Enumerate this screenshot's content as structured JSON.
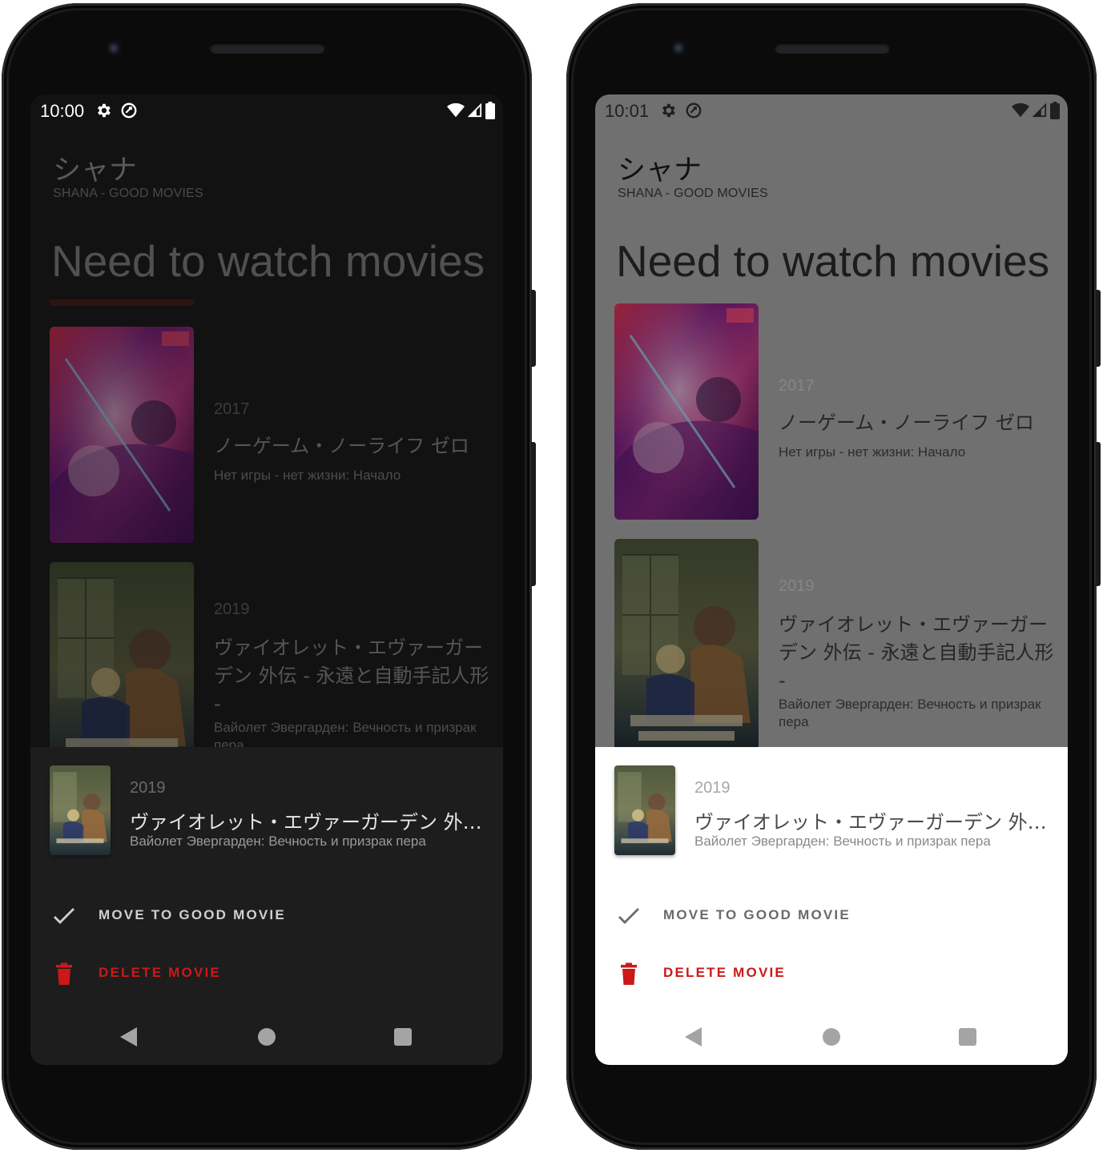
{
  "colors": {
    "accent_red": "#cc1818",
    "dark_sheet": "#1d1d1d",
    "dark_background": "#121212",
    "scrim_light": "#707070"
  },
  "left_phone": {
    "status": {
      "time": "10:00"
    },
    "app": {
      "title": "シャナ",
      "subtitle": "SHANA - GOOD MOVIES"
    },
    "section_title": "Need to watch movies",
    "movies": [
      {
        "year": "2017",
        "title": "ノーゲーム・ノーライフ ゼロ",
        "subtitle": "Нет игры - нет жизни: Начало"
      },
      {
        "year": "2019",
        "title": "ヴァイオレット・エヴァーガーデン 外伝 - 永遠と自動手記人形 -",
        "subtitle": "Вайолет Эвергарден: Вечность и призрак пера"
      }
    ],
    "sheet": {
      "year": "2019",
      "title": "ヴァイオレット・エヴァーガーデン 外伝 - 永遠と自動手記人形 -",
      "subtitle": "Вайолет Эвергарден: Вечность и призрак пера",
      "move_label": "MOVE TO GOOD MOVIE",
      "delete_label": "DELETE MOVIE"
    }
  },
  "right_phone": {
    "status": {
      "time": "10:01"
    },
    "app": {
      "title": "シャナ",
      "subtitle": "SHANA - GOOD MOVIES"
    },
    "section_title": "Need to watch movies",
    "movies": [
      {
        "year": "2017",
        "title": "ノーゲーム・ノーライフ ゼロ",
        "subtitle": "Нет игры - нет жизни: Начало"
      },
      {
        "year": "2019",
        "title": "ヴァイオレット・エヴァーガーデン 外伝 - 永遠と自動手記人形 -",
        "subtitle": "Вайолет Эвергарден: Вечность и призрак пера"
      }
    ],
    "sheet": {
      "year": "2019",
      "title": "ヴァイオレット・エヴァーガーデン 外伝 - 永遠と自動手記人形 -",
      "subtitle": "Вайолет Эвергарден: Вечность и призрак пера",
      "move_label": "MOVE TO GOOD MOVIE",
      "delete_label": "DELETE MOVIE"
    }
  },
  "icons": {
    "status_left": [
      "settings-icon",
      "sync-icon"
    ],
    "status_right": [
      "wifi-icon",
      "cell-signal-icon",
      "battery-icon"
    ],
    "sheet_actions": [
      "check-icon",
      "trash-icon"
    ],
    "nav": [
      "back-icon",
      "home-icon",
      "recents-icon"
    ]
  }
}
